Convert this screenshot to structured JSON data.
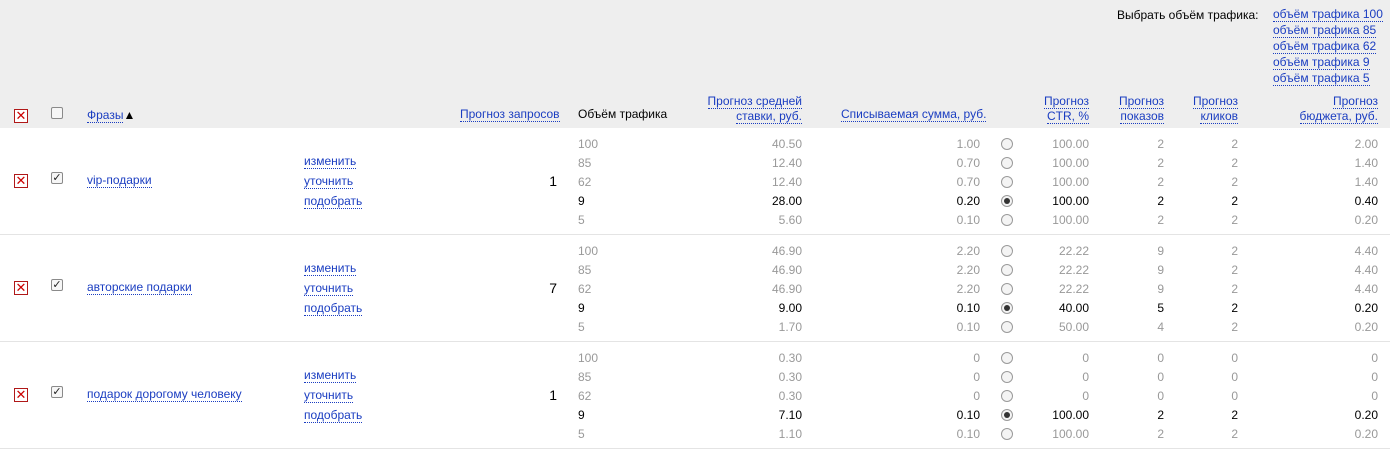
{
  "traffic_select": {
    "label": "Выбрать объём трафика:",
    "options": [
      "объём трафика 100",
      "объём трафика 85",
      "объём трафика 62",
      "объём трафика 9",
      "объём трафика 5"
    ]
  },
  "columns": {
    "phrases": "Фразы",
    "sort_arrow": "▲",
    "forecast_requests": "Прогноз запросов",
    "traffic_volume": "Объём трафика",
    "avg_bid_line1": "Прогноз средней",
    "avg_bid_line2": "ставки, руб.",
    "charged_amount": "Списываемая сумма, руб.",
    "ctr_line1": "Прогноз",
    "ctr_line2": "CTR, %",
    "shows_line1": "Прогноз",
    "shows_line2": "показов",
    "clicks_line1": "Прогноз",
    "clicks_line2": "кликов",
    "budget_line1": "Прогноз",
    "budget_line2": "бюджета, руб."
  },
  "actions": {
    "change": "изменить",
    "refine": "уточнить",
    "pick": "подобрать"
  },
  "icons": {
    "delete": "✕",
    "check": "✓"
  },
  "phrases": [
    {
      "text": "vip-подарки",
      "requests": "1",
      "checked": true,
      "selected": 3,
      "traffic": [
        "100",
        "85",
        "62",
        "9",
        "5"
      ],
      "bid": [
        "40.50",
        "12.40",
        "12.40",
        "28.00",
        "5.60"
      ],
      "charge": [
        "1.00",
        "0.70",
        "0.70",
        "0.20",
        "0.10"
      ],
      "ctr": [
        "100.00",
        "100.00",
        "100.00",
        "100.00",
        "100.00"
      ],
      "shows": [
        "2",
        "2",
        "2",
        "2",
        "2"
      ],
      "clicks": [
        "2",
        "2",
        "2",
        "2",
        "2"
      ],
      "budget": [
        "2.00",
        "1.40",
        "1.40",
        "0.40",
        "0.20"
      ]
    },
    {
      "text": "авторские подарки",
      "requests": "7",
      "checked": true,
      "selected": 3,
      "traffic": [
        "100",
        "85",
        "62",
        "9",
        "5"
      ],
      "bid": [
        "46.90",
        "46.90",
        "46.90",
        "9.00",
        "1.70"
      ],
      "charge": [
        "2.20",
        "2.20",
        "2.20",
        "0.10",
        "0.10"
      ],
      "ctr": [
        "22.22",
        "22.22",
        "22.22",
        "40.00",
        "50.00"
      ],
      "shows": [
        "9",
        "9",
        "9",
        "5",
        "4"
      ],
      "clicks": [
        "2",
        "2",
        "2",
        "2",
        "2"
      ],
      "budget": [
        "4.40",
        "4.40",
        "4.40",
        "0.20",
        "0.20"
      ]
    },
    {
      "text": "подарок дорогому человеку",
      "requests": "1",
      "checked": true,
      "selected": 3,
      "traffic": [
        "100",
        "85",
        "62",
        "9",
        "5"
      ],
      "bid": [
        "0.30",
        "0.30",
        "0.30",
        "7.10",
        "1.10"
      ],
      "charge": [
        "0",
        "0",
        "0",
        "0.10",
        "0.10"
      ],
      "ctr": [
        "0",
        "0",
        "0",
        "100.00",
        "100.00"
      ],
      "shows": [
        "0",
        "0",
        "0",
        "2",
        "2"
      ],
      "clicks": [
        "0",
        "0",
        "0",
        "2",
        "2"
      ],
      "budget": [
        "0",
        "0",
        "0",
        "0.20",
        "0.20"
      ]
    }
  ]
}
